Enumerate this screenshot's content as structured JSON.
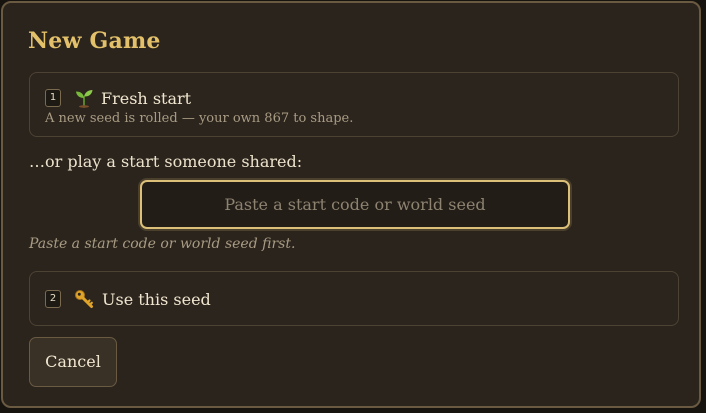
{
  "dialog": {
    "title": "New Game"
  },
  "fresh_start": {
    "key": "1",
    "icon": "seedling-icon",
    "label": "Fresh start",
    "description": "A new seed is rolled — your own 867 to shape."
  },
  "shared": {
    "label": "…or play a start someone shared:",
    "input_value": "",
    "input_placeholder": "Paste a start code or world seed",
    "hint": "Paste a start code or world seed first."
  },
  "use_seed": {
    "key": "2",
    "icon": "key-icon",
    "label": "Use this seed"
  },
  "cancel_label": "Cancel",
  "colors": {
    "title_gold": "#e3c06a",
    "panel_bg": "#2a241c",
    "input_focus_border": "#dcc07a"
  }
}
